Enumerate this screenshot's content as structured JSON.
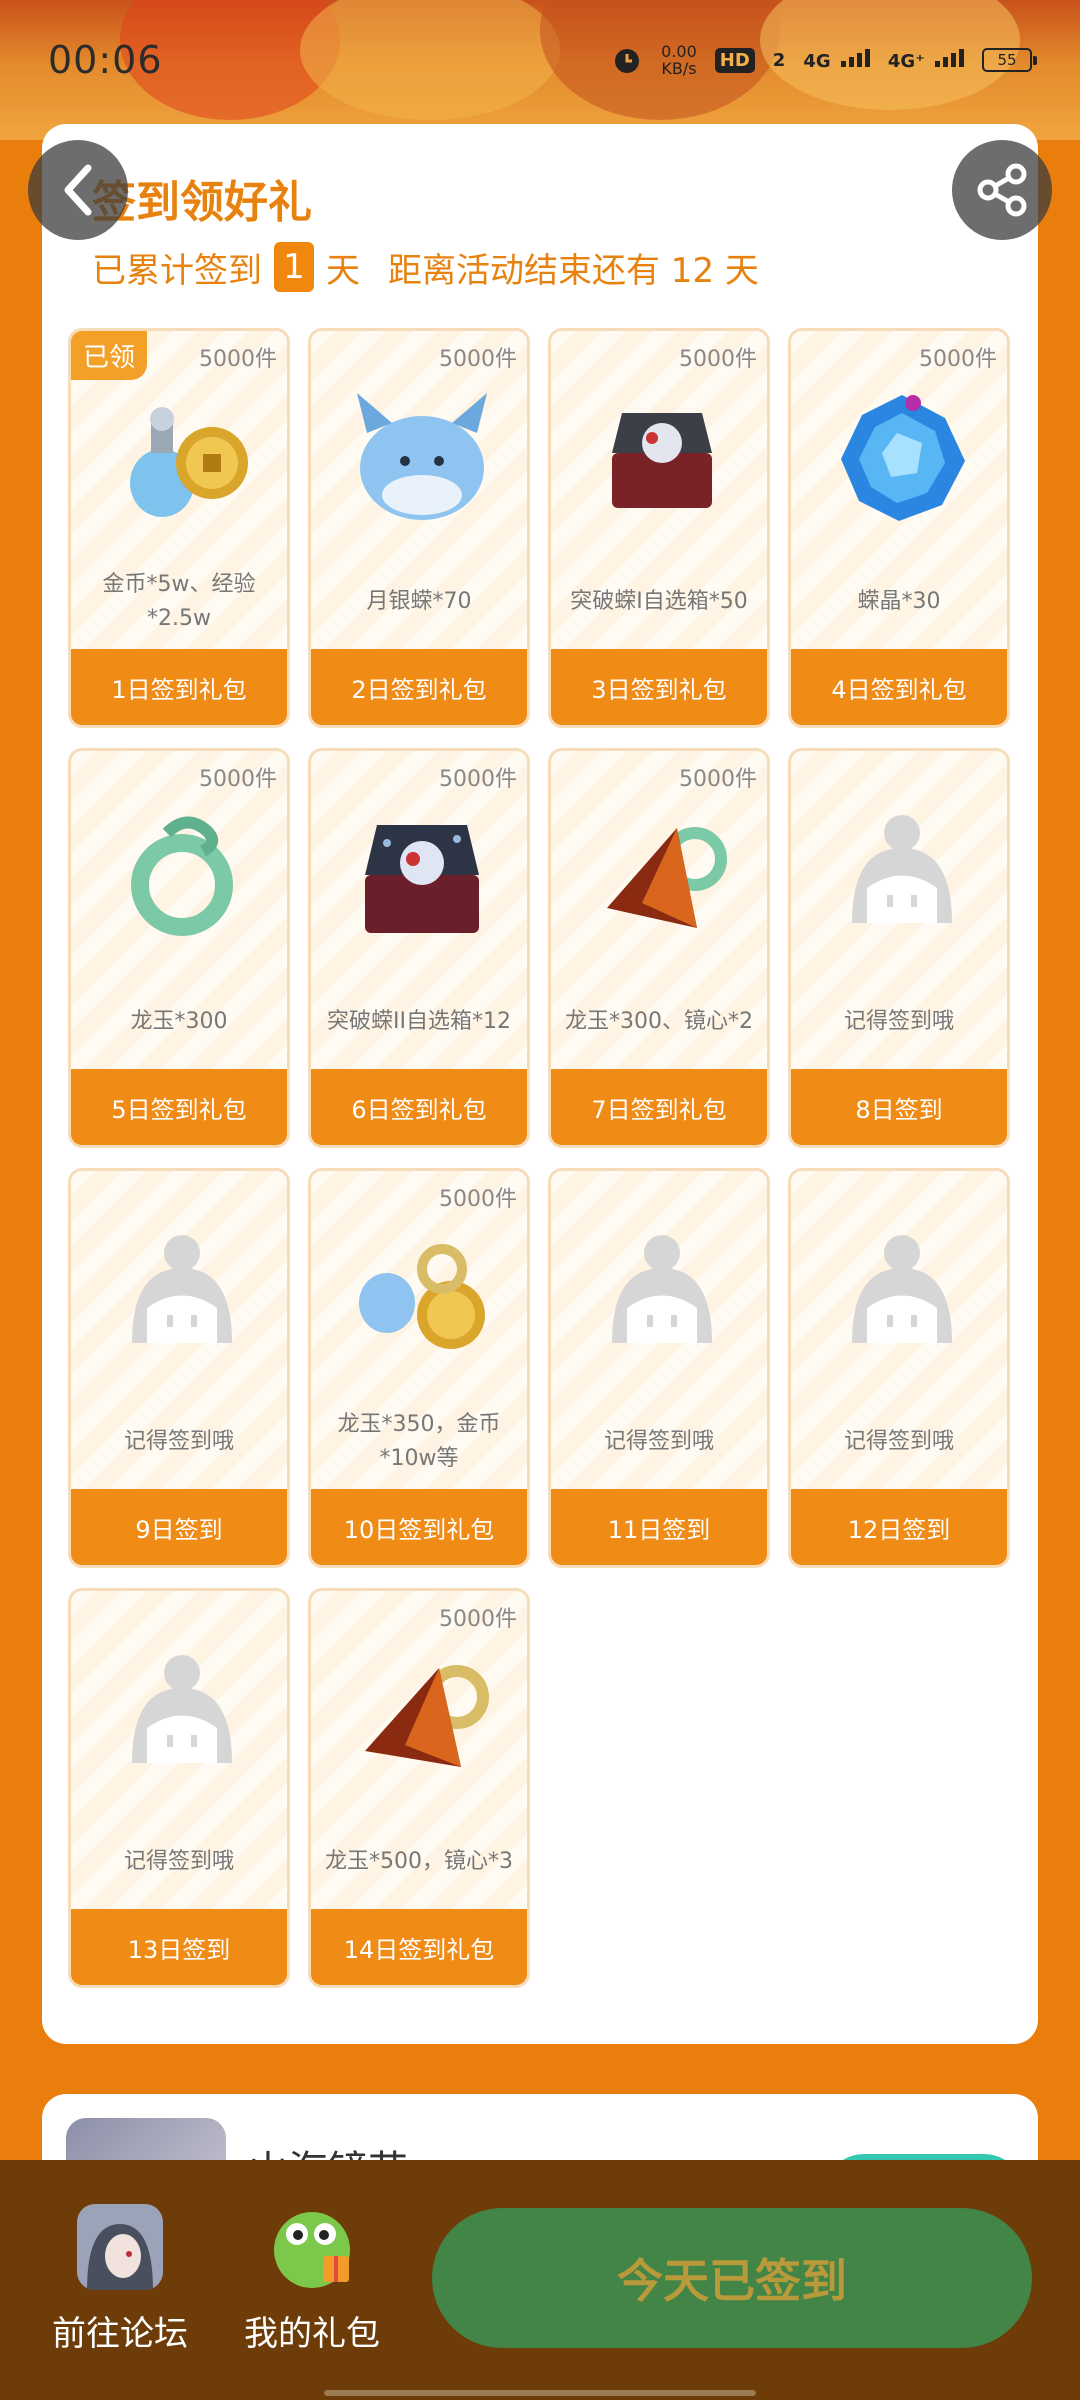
{
  "status_bar": {
    "time": "00:06",
    "net_speed": "0.00",
    "net_unit": "KB/s",
    "hd_label": "HD",
    "hd_sub": "2",
    "net1": "4G",
    "net2": "4G⁺",
    "battery": "55"
  },
  "header": {
    "title": "签到领好礼",
    "prefix": "已累计签到",
    "days": "1",
    "days_unit": "天",
    "remaining": "距离活动结束还有 12 天"
  },
  "rewards": [
    {
      "stock": "5000件",
      "claimed": "已领",
      "desc": "金币*5w、经验*2.5w",
      "label": "1日签到礼包",
      "icon": "coin-bottle-icon"
    },
    {
      "stock": "5000件",
      "claimed": "",
      "desc": "月银蝾*70",
      "label": "2日签到礼包",
      "icon": "blue-creature-icon"
    },
    {
      "stock": "5000件",
      "claimed": "",
      "desc": "突破蝾I自选箱*50",
      "label": "3日签到礼包",
      "icon": "chest-icon"
    },
    {
      "stock": "5000件",
      "claimed": "",
      "desc": "蝾晶*30",
      "label": "4日签到礼包",
      "icon": "crystal-icon"
    },
    {
      "stock": "5000件",
      "claimed": "",
      "desc": "龙玉*300",
      "label": "5日签到礼包",
      "icon": "dragon-jade-icon"
    },
    {
      "stock": "5000件",
      "claimed": "",
      "desc": "突破蝾II自选箱*12",
      "label": "6日签到礼包",
      "icon": "chest-icon"
    },
    {
      "stock": "5000件",
      "claimed": "",
      "desc": "龙玉*300、镜心*2",
      "label": "7日签到礼包",
      "icon": "jade-mirror-icon"
    },
    {
      "stock": "",
      "claimed": "",
      "desc": "记得签到哦",
      "label": "8日签到",
      "icon": "placeholder-mascot-icon"
    },
    {
      "stock": "",
      "claimed": "",
      "desc": "记得签到哦",
      "label": "9日签到",
      "icon": "placeholder-mascot-icon"
    },
    {
      "stock": "5000件",
      "claimed": "",
      "desc": "龙玉*350，金币*10w等",
      "label": "10日签到礼包",
      "icon": "bundle-icon"
    },
    {
      "stock": "",
      "claimed": "",
      "desc": "记得签到哦",
      "label": "11日签到",
      "icon": "placeholder-mascot-icon"
    },
    {
      "stock": "",
      "claimed": "",
      "desc": "记得签到哦",
      "label": "12日签到",
      "icon": "placeholder-mascot-icon"
    },
    {
      "stock": "",
      "claimed": "",
      "desc": "记得签到哦",
      "label": "13日签到",
      "icon": "placeholder-mascot-icon"
    },
    {
      "stock": "5000件",
      "claimed": "",
      "desc": "龙玉*500，镜心*3",
      "label": "14日签到礼包",
      "icon": "jade-mirror-icon"
    }
  ],
  "secondary": {
    "game_name": "山海镜花"
  },
  "bottom_bar": {
    "forum_label": "前往论坛",
    "gifts_label": "我的礼包",
    "checkin_label": "今天已签到"
  },
  "colors": {
    "accent": "#f08b16",
    "background": "#e97e0c",
    "button_done": "#438447",
    "bottom_bar": "#6e3c09"
  }
}
